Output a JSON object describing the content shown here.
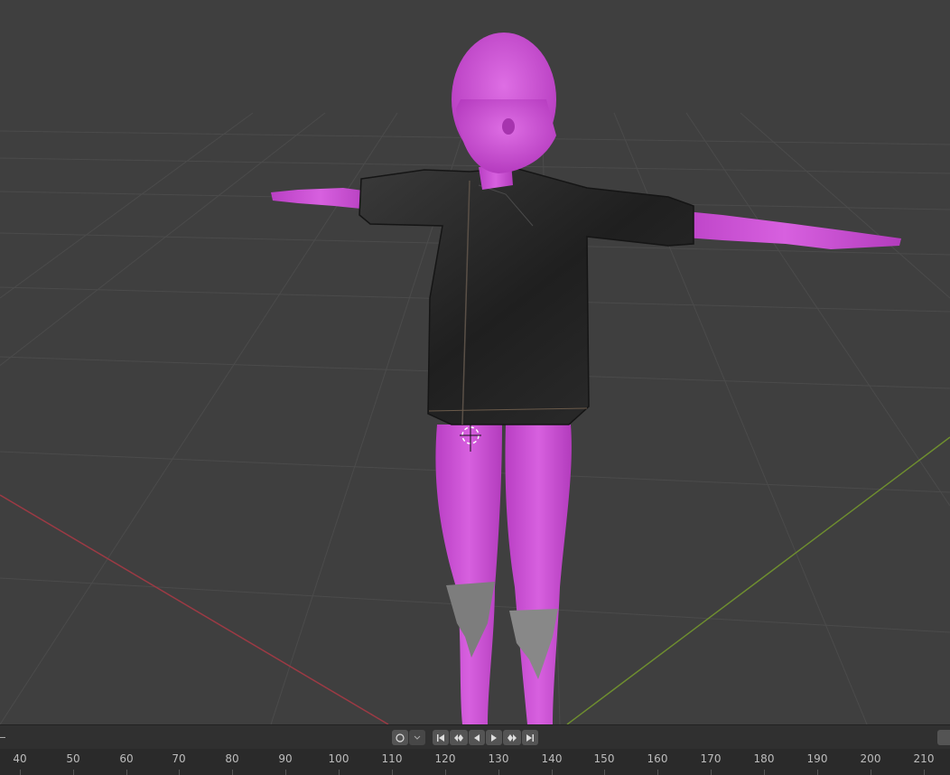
{
  "app": "Blender",
  "viewport": {
    "background": "#3f3f3f",
    "grid_color": "#4a4a4a",
    "x_axis_color": "#9c3a44",
    "y_axis_color": "#6f8f2f",
    "character_skin_color": "#c84ad2",
    "jacket_color": "#262626",
    "boot_color": "#7d7d7d"
  },
  "timeline": {
    "controls": {
      "keying_icon": "record-circle-icon",
      "jump_start": "jump-to-start-icon",
      "prev_keyframe": "previous-keyframe-icon",
      "play_reverse": "play-reverse-icon",
      "play": "play-icon",
      "next_keyframe": "next-keyframe-icon",
      "jump_end": "jump-to-end-icon"
    },
    "ruler_labels": [
      "40",
      "50",
      "60",
      "70",
      "80",
      "90",
      "100",
      "110",
      "120",
      "130",
      "140",
      "150",
      "160",
      "170",
      "180",
      "190",
      "200",
      "210"
    ]
  }
}
